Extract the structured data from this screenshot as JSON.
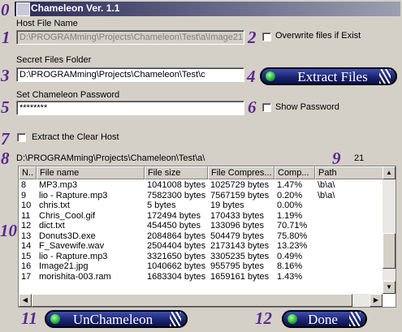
{
  "window": {
    "title": "Chameleon Ver. 1.1"
  },
  "numbers": [
    "0",
    "1",
    "2",
    "3",
    "4",
    "5",
    "6",
    "7",
    "8",
    "9",
    "10",
    "11",
    "12"
  ],
  "host_file": {
    "label": "Host File Name",
    "value": "D:\\PROGRAMming\\Projects\\Chameleon\\Test\\a\\Image21"
  },
  "overwrite": {
    "label": "Overwrite files if Exist",
    "checked": false
  },
  "secret_folder": {
    "label": "Secret Files Folder",
    "value": "D:\\PROGRAMming\\Projects\\Chameleon\\Test\\c"
  },
  "extract_button": {
    "label": "Extract Files"
  },
  "password": {
    "label": "Set Chameleon Password",
    "value": "********"
  },
  "show_password": {
    "label": "Show Password",
    "checked": false
  },
  "extract_clear_host": {
    "label": "Extract the Clear Host",
    "checked": false
  },
  "path_display": "D:\\PROGRAMming\\Projects\\Chameleon\\Test\\a\\",
  "file_count": "21",
  "table": {
    "columns": [
      "N..",
      "File name",
      "File size",
      "File Compres...",
      "Comp...",
      "Path"
    ],
    "rows": [
      [
        "8",
        "MP3.mp3",
        "1041008 bytes",
        "1025729 bytes",
        "1.47%",
        "\\b\\a\\"
      ],
      [
        "9",
        "lio - Rapture.mp3",
        "7582300 bytes",
        "7567159 bytes",
        "0.20%",
        "\\b\\a\\"
      ],
      [
        "10",
        "chris.txt",
        "5 bytes",
        "19 bytes",
        "0.00%",
        ""
      ],
      [
        "11",
        "Chris_Cool.gif",
        "172494 bytes",
        "170433 bytes",
        "1.19%",
        ""
      ],
      [
        "12",
        "dict.txt",
        "454450 bytes",
        "133096 bytes",
        "70.71%",
        ""
      ],
      [
        "13",
        "Donuts3D.exe",
        "2084864 bytes",
        "504479 bytes",
        "75.80%",
        ""
      ],
      [
        "14",
        "F_Savewife.wav",
        "2504404 bytes",
        "2173143 bytes",
        "13.23%",
        ""
      ],
      [
        "15",
        "lio - Rapture.mp3",
        "3321650 bytes",
        "3305235 bytes",
        "0.49%",
        ""
      ],
      [
        "16",
        "Image21.jpg",
        "1040662 bytes",
        "955795 bytes",
        "8.16%",
        ""
      ],
      [
        "17",
        "morishita-003.ram",
        "1683304 bytes",
        "1659161 bytes",
        "1.43%",
        ""
      ]
    ]
  },
  "unchameleon_button": {
    "label": "UnChameleon"
  },
  "done_button": {
    "label": "Done"
  },
  "colors": {
    "number_color": "#5a2890",
    "pill_blue": "#1a2470",
    "window_bg": "#d4d0c8"
  }
}
